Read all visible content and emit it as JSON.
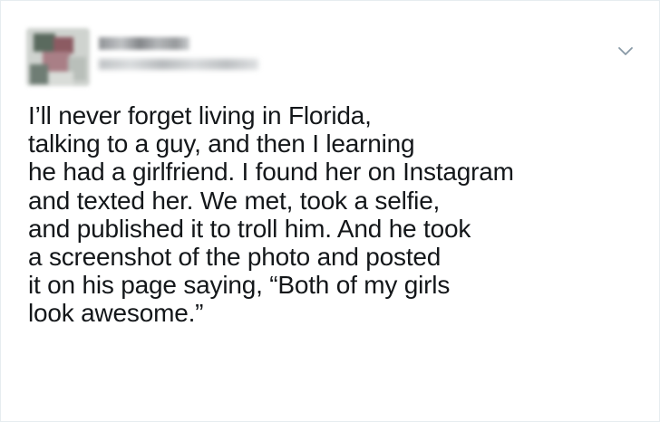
{
  "tweet": {
    "lines": [
      "I’ll never forget living in Florida,",
      "talking to a guy, and then I learning",
      "he had a girlfriend. I found her on Instagram",
      "and texted her. We met, took a selfie,",
      "and published it to troll him. And he took",
      "a screenshot of the photo and posted",
      "it on his page saying, “Both of my girls",
      "look awesome.”"
    ]
  },
  "header": {
    "menu_icon": "chevron-down-icon",
    "avatar_icon": "avatar"
  },
  "colors": {
    "text": "#14171a",
    "border": "#e6ecf0",
    "chevron": "#8899a6"
  }
}
